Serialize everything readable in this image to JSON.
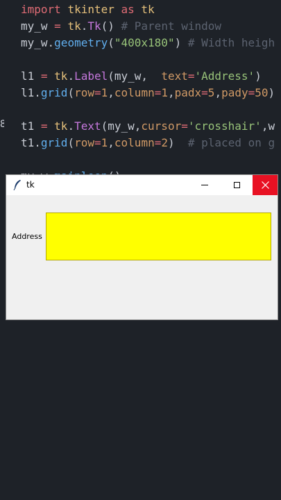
{
  "editor": {
    "lines": [
      {
        "tokens": [
          [
            "kw",
            "import "
          ],
          [
            "mod",
            "tkinter "
          ],
          [
            "kw",
            "as "
          ],
          [
            "mod",
            "tk"
          ]
        ]
      },
      {
        "tokens": [
          [
            "plain",
            "my_w "
          ],
          [
            "kw",
            "= "
          ],
          [
            "mod",
            "tk"
          ],
          [
            "plain",
            "."
          ],
          [
            "cls",
            "Tk"
          ],
          [
            "plain",
            "() "
          ],
          [
            "cmt",
            "# Parent window"
          ]
        ]
      },
      {
        "tokens": [
          [
            "plain",
            "my_w."
          ],
          [
            "fn",
            "geometry"
          ],
          [
            "plain",
            "("
          ],
          [
            "str",
            "\"400x180\""
          ],
          [
            "plain",
            ") "
          ],
          [
            "cmt",
            "# Width heigh"
          ]
        ]
      },
      {
        "tokens": []
      },
      {
        "tokens": [
          [
            "plain",
            "l1 "
          ],
          [
            "kw",
            "= "
          ],
          [
            "mod",
            "tk"
          ],
          [
            "plain",
            "."
          ],
          [
            "cls",
            "Label"
          ],
          [
            "plain",
            "(my_w,  "
          ],
          [
            "param",
            "text"
          ],
          [
            "kw",
            "="
          ],
          [
            "str",
            "'Address'"
          ],
          [
            "plain",
            ")"
          ]
        ]
      },
      {
        "tokens": [
          [
            "plain",
            "l1."
          ],
          [
            "fn",
            "grid"
          ],
          [
            "plain",
            "("
          ],
          [
            "param",
            "row"
          ],
          [
            "kw",
            "="
          ],
          [
            "num",
            "1"
          ],
          [
            "plain",
            ","
          ],
          [
            "param",
            "column"
          ],
          [
            "kw",
            "="
          ],
          [
            "num",
            "1"
          ],
          [
            "plain",
            ","
          ],
          [
            "param",
            "padx"
          ],
          [
            "kw",
            "="
          ],
          [
            "num",
            "5"
          ],
          [
            "plain",
            ","
          ],
          [
            "param",
            "pady"
          ],
          [
            "kw",
            "="
          ],
          [
            "num",
            "50"
          ],
          [
            "plain",
            ")"
          ]
        ]
      },
      {
        "tokens": []
      },
      {
        "tokens": [
          [
            "plain",
            "t1 "
          ],
          [
            "kw",
            "= "
          ],
          [
            "mod",
            "tk"
          ],
          [
            "plain",
            "."
          ],
          [
            "cls",
            "Text"
          ],
          [
            "plain",
            "(my_w,"
          ],
          [
            "param",
            "cursor"
          ],
          [
            "kw",
            "="
          ],
          [
            "str",
            "'crosshair'"
          ],
          [
            "plain",
            ",w"
          ]
        ]
      },
      {
        "tokens": [
          [
            "plain",
            "t1."
          ],
          [
            "fn",
            "grid"
          ],
          [
            "plain",
            "("
          ],
          [
            "param",
            "row"
          ],
          [
            "kw",
            "="
          ],
          [
            "num",
            "1"
          ],
          [
            "plain",
            ","
          ],
          [
            "param",
            "column"
          ],
          [
            "kw",
            "="
          ],
          [
            "num",
            "2"
          ],
          [
            "plain",
            ")  "
          ],
          [
            "cmt",
            "# placed on g"
          ]
        ]
      },
      {
        "tokens": []
      },
      {
        "tokens": [
          [
            "plain",
            "my_w."
          ],
          [
            "fn",
            "mainloop"
          ],
          [
            "plain",
            "()"
          ]
        ]
      }
    ]
  },
  "tk_window": {
    "title": "tk",
    "minimize_glyph": "—",
    "close_glyph": "✕",
    "label_text": "Address",
    "text_widget_bg": "#ffff00"
  },
  "colors": {
    "editor_bg": "#1e2228",
    "close_button": "#e81123",
    "window_bg": "#f0f0f0"
  }
}
